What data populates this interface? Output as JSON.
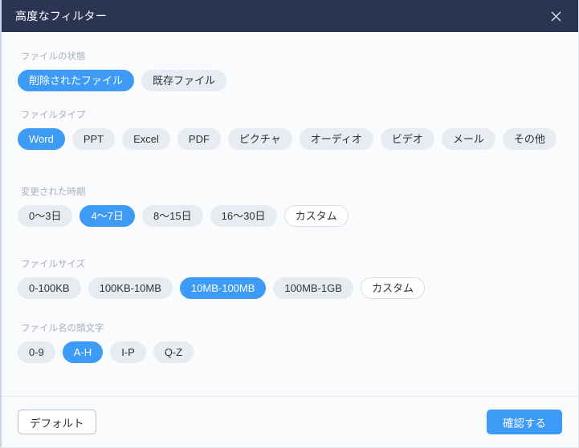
{
  "window": {
    "title": "高度なフィルター",
    "close_icon": "close-icon",
    "titlebar_color": "#2b3553",
    "accent_color": "#3d9bf5"
  },
  "sections": [
    {
      "key": "file_status",
      "label": "ファイルの状態",
      "options": [
        {
          "label": "削除されたファイル",
          "state": "selected"
        },
        {
          "label": "既存ファイル",
          "state": "normal"
        }
      ]
    },
    {
      "key": "file_type",
      "label": "ファイルタイプ",
      "options": [
        {
          "label": "Word",
          "state": "selected"
        },
        {
          "label": "PPT",
          "state": "normal"
        },
        {
          "label": "Excel",
          "state": "normal"
        },
        {
          "label": "PDF",
          "state": "normal"
        },
        {
          "label": "ピクチャ",
          "state": "normal"
        },
        {
          "label": "オーディオ",
          "state": "normal"
        },
        {
          "label": "ビデオ",
          "state": "normal"
        },
        {
          "label": "メール",
          "state": "normal"
        },
        {
          "label": "その他",
          "state": "normal"
        }
      ]
    },
    {
      "key": "modified_time",
      "label": "変更された時期",
      "options": [
        {
          "label": "0〜3日",
          "state": "normal"
        },
        {
          "label": "4〜7日",
          "state": "selected"
        },
        {
          "label": "8〜15日",
          "state": "normal"
        },
        {
          "label": "16〜30日",
          "state": "normal"
        },
        {
          "label": "カスタム",
          "state": "outline"
        }
      ]
    },
    {
      "key": "file_size",
      "label": "ファイルサイズ",
      "options": [
        {
          "label": "0-100KB",
          "state": "normal"
        },
        {
          "label": "100KB-10MB",
          "state": "normal"
        },
        {
          "label": "10MB-100MB",
          "state": "selected"
        },
        {
          "label": "100MB-1GB",
          "state": "normal"
        },
        {
          "label": "カスタム",
          "state": "outline"
        }
      ]
    },
    {
      "key": "filename_initial",
      "label": "ファイル名の頭文字",
      "options": [
        {
          "label": "0-9",
          "state": "normal"
        },
        {
          "label": "A-H",
          "state": "selected"
        },
        {
          "label": "I-P",
          "state": "normal"
        },
        {
          "label": "Q-Z",
          "state": "normal"
        }
      ]
    }
  ],
  "footer": {
    "default_label": "デフォルト",
    "confirm_label": "確認する"
  }
}
